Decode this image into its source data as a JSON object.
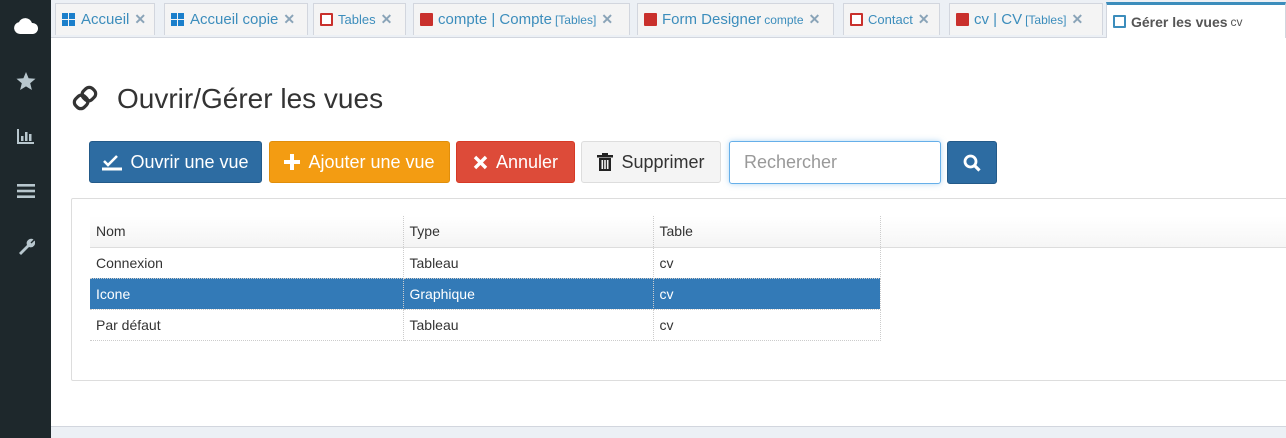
{
  "sidebar": {
    "icons": [
      "cloud-icon",
      "star-icon",
      "bar-chart-icon",
      "menu-icon",
      "wrench-icon"
    ]
  },
  "tabs": [
    {
      "icon": "windows-icon",
      "label": "Accueil",
      "sub": ""
    },
    {
      "icon": "windows-icon",
      "label": "Accueil copie",
      "sub": ""
    },
    {
      "icon": "table-outline-icon",
      "label": "Tables",
      "sub": ""
    },
    {
      "icon": "table-fill-icon",
      "label": "compte | Compte",
      "sub": "[Tables]"
    },
    {
      "icon": "table-fill-icon",
      "label": "Form Designer",
      "sub": "compte"
    },
    {
      "icon": "table-outline-icon",
      "label": "Contact",
      "sub": ""
    },
    {
      "icon": "table-fill-icon",
      "label": "cv | CV",
      "sub": "[Tables]"
    },
    {
      "icon": "view-icon",
      "label": "Gérer les vues",
      "sub": "cv"
    }
  ],
  "page": {
    "title": "Ouvrir/Gérer les vues"
  },
  "toolbar": {
    "open_label": "Ouvrir une vue",
    "add_label": "Ajouter une vue",
    "cancel_label": "Annuler",
    "delete_label": "Supprimer",
    "search_placeholder": "Rechercher",
    "search_value": ""
  },
  "table": {
    "columns": [
      "Nom",
      "Type",
      "Table"
    ],
    "rows": [
      {
        "nom": "Connexion",
        "type": "Tableau",
        "table": "cv",
        "selected": false
      },
      {
        "nom": "Icone",
        "type": "Graphique",
        "table": "cv",
        "selected": true
      },
      {
        "nom": "Par défaut",
        "type": "Tableau",
        "table": "cv",
        "selected": false
      }
    ]
  },
  "colors": {
    "sidebar": "#1e282c",
    "primary": "#2d6ca2",
    "warning": "#f39c12",
    "danger": "#dd4b39",
    "selected_row": "#337ab7"
  }
}
